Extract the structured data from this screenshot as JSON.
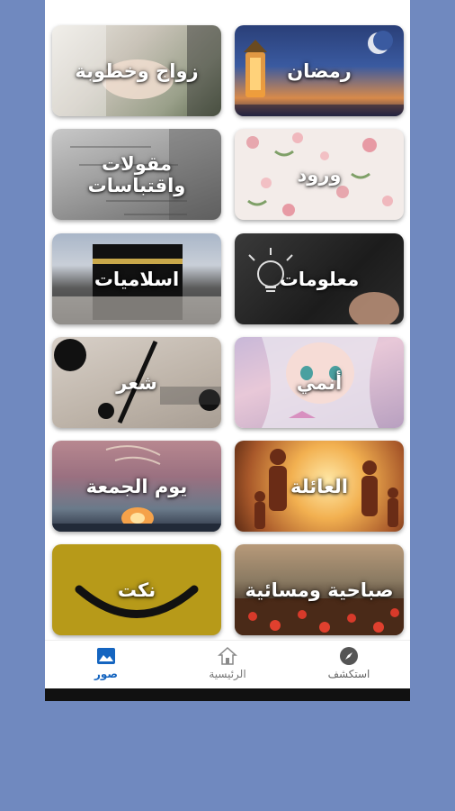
{
  "categories": [
    {
      "id": "ramadan",
      "label": "رمضان"
    },
    {
      "id": "wedding",
      "label": "زواج وخطوبة"
    },
    {
      "id": "roses",
      "label": "ورود"
    },
    {
      "id": "quotes",
      "label": "مقولات واقتباسات"
    },
    {
      "id": "info",
      "label": "معلومات"
    },
    {
      "id": "islamic",
      "label": "اسلاميات"
    },
    {
      "id": "anime",
      "label": "أنمي"
    },
    {
      "id": "poetry",
      "label": "شعر"
    },
    {
      "id": "family",
      "label": "العائلة"
    },
    {
      "id": "friday",
      "label": "يوم الجمعة"
    },
    {
      "id": "morning",
      "label": "صباحية ومسائية"
    },
    {
      "id": "jokes",
      "label": "نكت"
    }
  ],
  "nav": {
    "explore": {
      "label": "استكشف",
      "icon": "compass-icon"
    },
    "home": {
      "label": "الرئيسية",
      "icon": "house-icon"
    },
    "photos": {
      "label": "صور",
      "icon": "image-icon",
      "active": true
    }
  },
  "colors": {
    "accent": "#1565c0",
    "nav_inactive": "#666666",
    "page_background": "#7089bf"
  }
}
